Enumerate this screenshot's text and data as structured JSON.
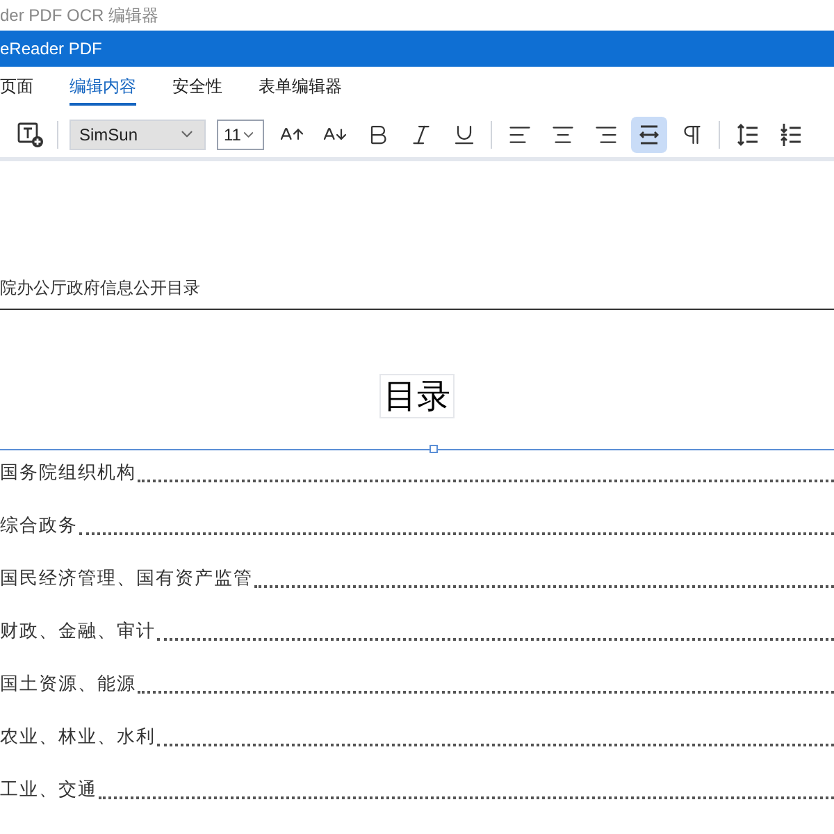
{
  "window": {
    "title": "der PDF OCR 编辑器"
  },
  "app_bar": {
    "title": "eReader PDF"
  },
  "tabs": [
    {
      "label": "页面",
      "selected": false
    },
    {
      "label": "编辑内容",
      "selected": true
    },
    {
      "label": "安全性",
      "selected": false
    },
    {
      "label": "表单编辑器",
      "selected": false
    }
  ],
  "toolbar": {
    "font": "SimSun",
    "size": "11",
    "buttons": [
      {
        "kind": "add_text",
        "selected": false
      },
      {
        "kind": "separator"
      },
      {
        "kind": "font"
      },
      {
        "kind": "size"
      },
      {
        "kind": "grow",
        "selected": false
      },
      {
        "kind": "shrink",
        "selected": false
      },
      {
        "kind": "bold",
        "selected": false
      },
      {
        "kind": "italic",
        "selected": false
      },
      {
        "kind": "underline",
        "selected": false
      },
      {
        "kind": "separator"
      },
      {
        "kind": "align_left",
        "selected": false
      },
      {
        "kind": "align_center",
        "selected": false
      },
      {
        "kind": "align_right",
        "selected": false
      },
      {
        "kind": "fit_width",
        "selected": true
      },
      {
        "kind": "direction",
        "selected": false
      },
      {
        "kind": "separator"
      },
      {
        "kind": "line_spacing",
        "selected": false
      },
      {
        "kind": "paragraph_spacing",
        "selected": false
      }
    ]
  },
  "document": {
    "header": "院办公厅政府信息公开目录",
    "title": "目录",
    "entries": [
      "国务院组织机构",
      "综合政务",
      "国民经济管理、国有资产监管",
      "财政、金融、审计",
      "国土资源、能源",
      "农业、林业、水利",
      "工业、交通"
    ]
  }
}
